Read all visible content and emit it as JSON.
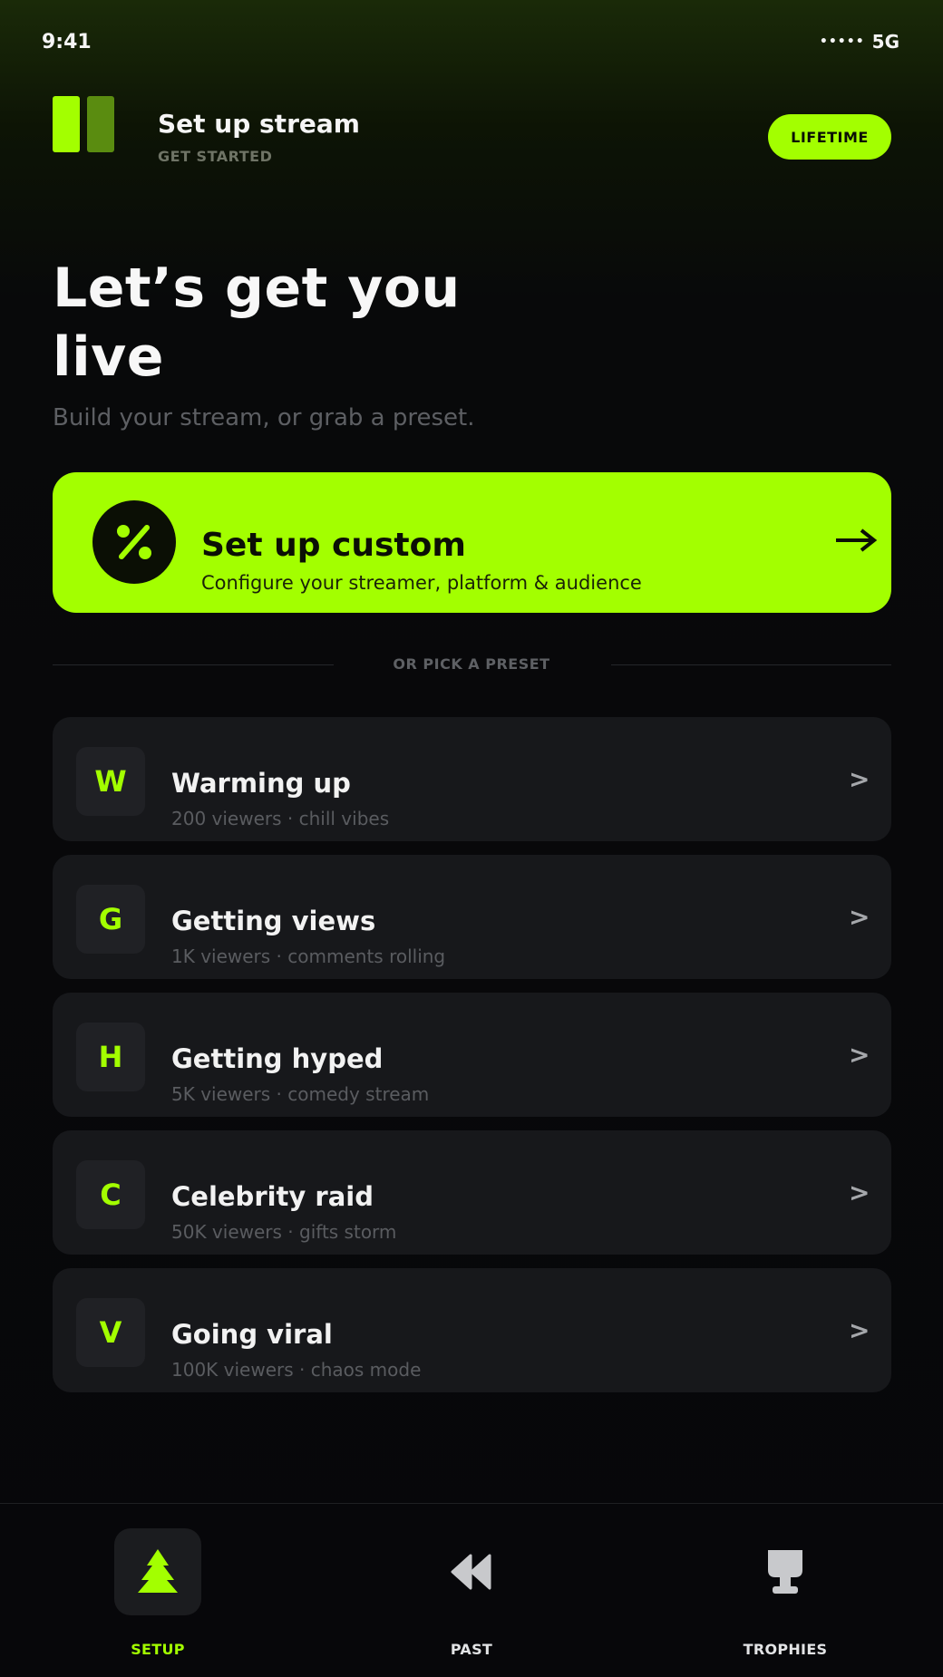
{
  "status_bar": {
    "time": "9:41",
    "signal": "•••••",
    "network": "5G"
  },
  "header": {
    "title": "Set up stream",
    "subtitle": "GET STARTED",
    "badge": "LIFETIME"
  },
  "hero": {
    "title": "Let’s get you live",
    "subtitle": "Build your stream, or grab a preset."
  },
  "custom_card": {
    "title": "Set up custom",
    "subtitle": "Configure your streamer, platform & audience"
  },
  "divider": {
    "label": "OR PICK A PRESET"
  },
  "presets": [
    {
      "letter": "W",
      "title": "Warming up",
      "subtitle": "200 viewers · chill vibes",
      "chevron": ">"
    },
    {
      "letter": "G",
      "title": "Getting views",
      "subtitle": "1K viewers · comments rolling",
      "chevron": ">"
    },
    {
      "letter": "H",
      "title": "Getting hyped",
      "subtitle": "5K viewers · comedy stream",
      "chevron": ">"
    },
    {
      "letter": "C",
      "title": "Celebrity raid",
      "subtitle": "50K viewers · gifts storm",
      "chevron": ">"
    },
    {
      "letter": "V",
      "title": "Going viral",
      "subtitle": "100K viewers · chaos mode",
      "chevron": ">"
    }
  ],
  "nav": [
    {
      "label": "SETUP",
      "icon": "tree-icon",
      "active": true
    },
    {
      "label": "PAST",
      "icon": "rewind-icon",
      "active": false
    },
    {
      "label": "TROPHIES",
      "icon": "trophy-icon",
      "active": false
    }
  ],
  "colors": {
    "accent": "#a3ff00",
    "background": "#07070a",
    "card": "#17181b",
    "muted": "#5a5c60",
    "inactive_nav": "#c8c9cc"
  }
}
